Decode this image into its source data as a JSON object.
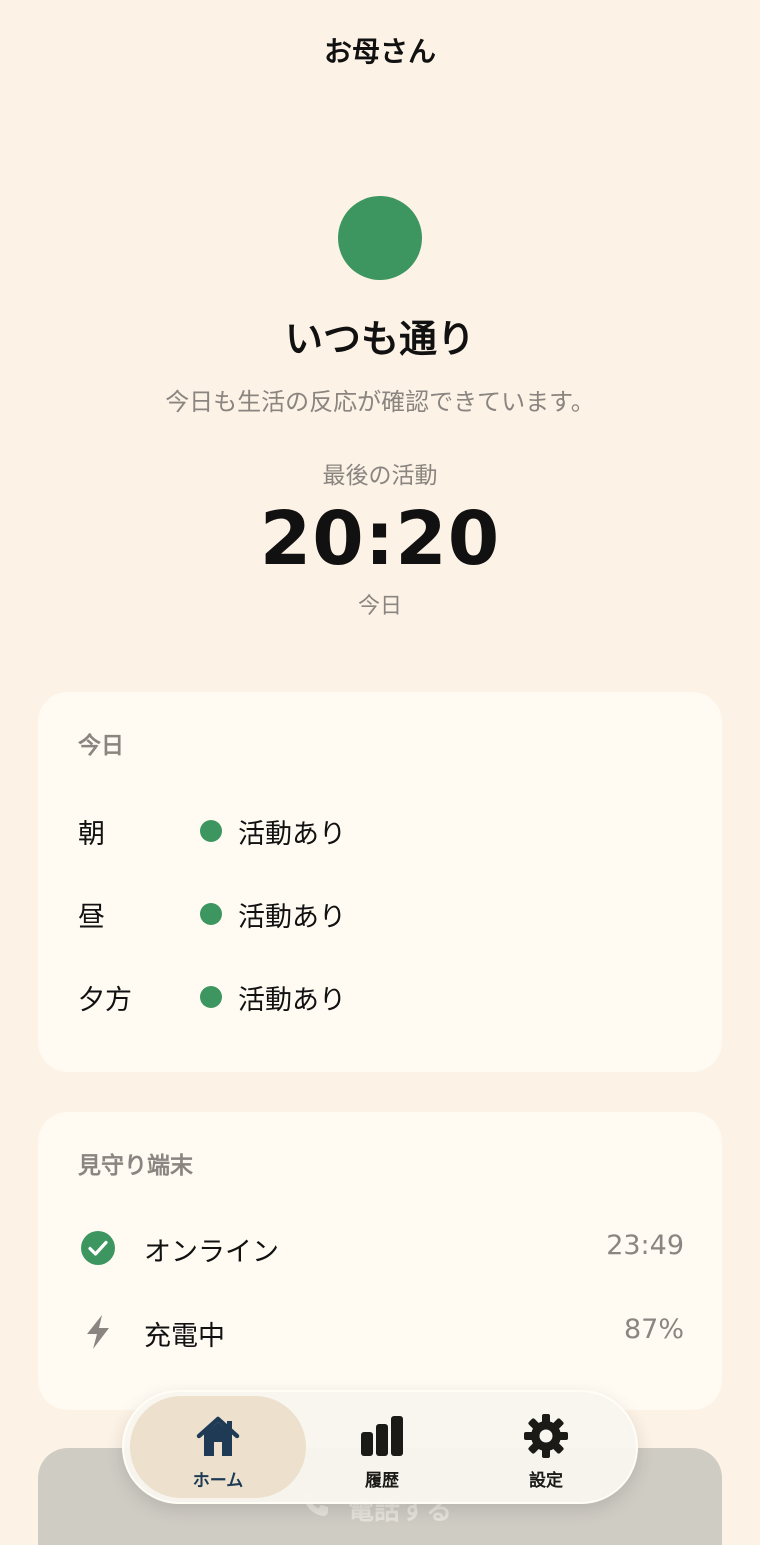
{
  "header": {
    "title": "お母さん"
  },
  "status": {
    "color": "#3d9660",
    "title": "いつも通り",
    "subtitle": "今日も生活の反応が確認できています。"
  },
  "last_activity": {
    "label": "最後の活動",
    "time": "20:20",
    "day": "今日"
  },
  "today_card": {
    "title": "今日",
    "rows": [
      {
        "period": "朝",
        "status": "活動あり"
      },
      {
        "period": "昼",
        "status": "活動あり"
      },
      {
        "period": "夕方",
        "status": "活動あり"
      }
    ]
  },
  "device_card": {
    "title": "見守り端末",
    "online": {
      "icon": "check-circle-icon",
      "label": "オンライン",
      "value": "23:49"
    },
    "charging": {
      "icon": "lightning-icon",
      "label": "充電中",
      "value": "87%"
    }
  },
  "call_button": {
    "icon": "phone-icon",
    "label": "電話する"
  },
  "nav": {
    "items": [
      {
        "icon": "home-icon",
        "label": "ホーム",
        "active": true
      },
      {
        "icon": "bar-chart-icon",
        "label": "履歴",
        "active": false
      },
      {
        "icon": "gear-icon",
        "label": "設定",
        "active": false
      }
    ]
  },
  "colors": {
    "background": "#fcf2e6",
    "card": "#fffbf3",
    "accent_green": "#3d9660",
    "nav_active": "#1e3a55"
  }
}
